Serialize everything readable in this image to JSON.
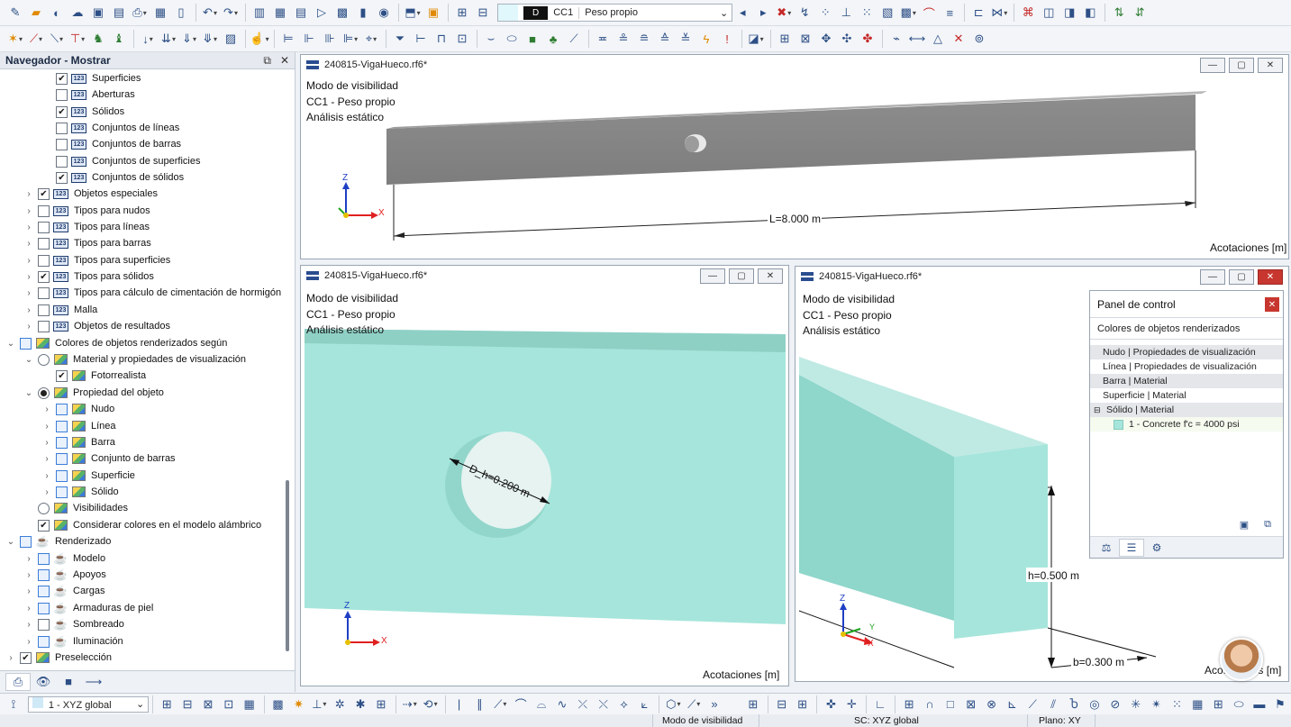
{
  "toolbar1": {
    "load_case_tag": "D",
    "load_case_code": "CC1",
    "load_case_name": "Peso propio"
  },
  "navigator": {
    "title": "Navegador - Mostrar",
    "items": [
      {
        "label": "Superficies",
        "checked": true
      },
      {
        "label": "Aberturas",
        "checked": false
      },
      {
        "label": "Sólidos",
        "checked": true
      },
      {
        "label": "Conjuntos de líneas",
        "checked": false
      },
      {
        "label": "Conjuntos de barras",
        "checked": false
      },
      {
        "label": "Conjuntos de superficies",
        "checked": false
      },
      {
        "label": "Conjuntos de sólidos",
        "checked": true
      },
      {
        "label": "Objetos especiales",
        "checked": true
      },
      {
        "label": "Tipos para nudos",
        "checked": false
      },
      {
        "label": "Tipos para líneas",
        "checked": false
      },
      {
        "label": "Tipos para barras",
        "checked": false
      },
      {
        "label": "Tipos para superficies",
        "checked": false
      },
      {
        "label": "Tipos para sólidos",
        "checked": true
      },
      {
        "label": "Tipos para cálculo de cimentación de hormigón",
        "checked": false
      },
      {
        "label": "Malla",
        "checked": false
      },
      {
        "label": "Objetos de resultados",
        "checked": false
      },
      {
        "label": "Colores de objetos renderizados según"
      },
      {
        "label": "Material y propiedades de visualización"
      },
      {
        "label": "Fotorrealista",
        "checked": true
      },
      {
        "label": "Propiedad del objeto"
      },
      {
        "label": "Nudo"
      },
      {
        "label": "Línea"
      },
      {
        "label": "Barra"
      },
      {
        "label": "Conjunto de barras"
      },
      {
        "label": "Superficie"
      },
      {
        "label": "Sólido"
      },
      {
        "label": "Visibilidades"
      },
      {
        "label": "Considerar colores en el modelo alámbrico",
        "checked": true
      },
      {
        "label": "Renderizado"
      },
      {
        "label": "Modelo"
      },
      {
        "label": "Apoyos"
      },
      {
        "label": "Cargas"
      },
      {
        "label": "Armaduras de piel"
      },
      {
        "label": "Sombreado",
        "checked": false
      },
      {
        "label": "Iluminación"
      },
      {
        "label": "Preselección",
        "checked": true
      }
    ]
  },
  "windows": {
    "top": {
      "title": "240815-VigaHueco.rf6*",
      "info": [
        "Modo de visibilidad",
        "CC1 - Peso propio",
        "Análisis estático"
      ],
      "dimension": "L=8.000 m",
      "footer": "Acotaciones [m]"
    },
    "left": {
      "title": "240815-VigaHueco.rf6*",
      "info": [
        "Modo de visibilidad",
        "CC1 - Peso propio",
        "Análisis estático"
      ],
      "dimension": "D_h=0.200 m",
      "footer": "Acotaciones [m]"
    },
    "right": {
      "title": "240815-VigaHueco.rf6*",
      "info": [
        "Modo de visibilidad",
        "CC1 - Peso propio",
        "Análisis estático"
      ],
      "dim_h": "h=0.500 m",
      "dim_b": "b=0.300 m",
      "footer": "Acotaciones [m]"
    }
  },
  "axes": {
    "x": "X",
    "y": "Y",
    "z": "Z"
  },
  "control_panel": {
    "title": "Panel de control",
    "subtitle": "Colores de objetos renderizados",
    "rows": [
      "Nudo | Propiedades de visualización",
      "Línea | Propiedades de visualización",
      "Barra | Material",
      "Superficie | Material",
      "Sólido | Material"
    ],
    "material": "1 - Concrete f'c = 4000 psi",
    "material_color": "#a6e5db"
  },
  "bottom_bar": {
    "coord_system": "1 - XYZ global"
  },
  "status_bar": {
    "mode": "Modo de visibilidad",
    "cs": "SC: XYZ global",
    "plane": "Plano: XY"
  },
  "colors": {
    "concrete_grey": "#8f8f8f",
    "solid_mint": "#a6e5db",
    "axis_x": "#e02020",
    "axis_y": "#1aa31a",
    "axis_z": "#1f3fc4"
  }
}
